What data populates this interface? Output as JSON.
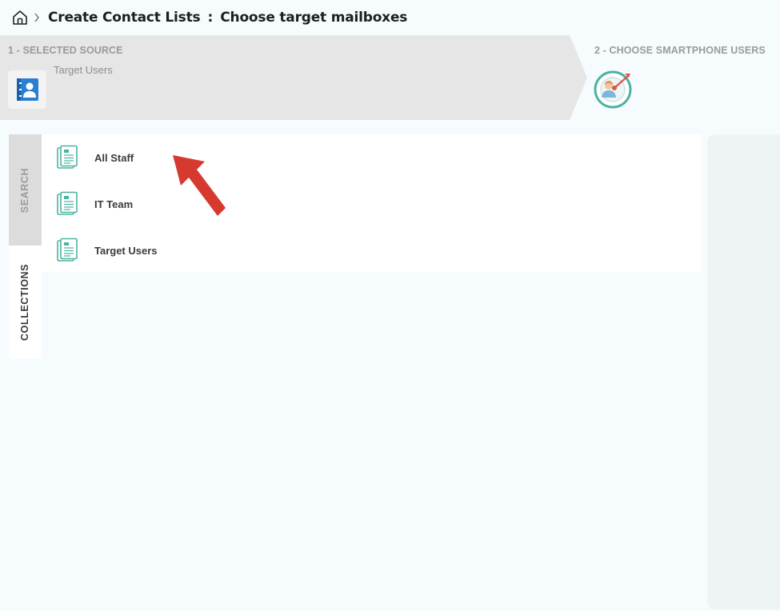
{
  "header": {
    "home_icon": "home-icon",
    "chevron_icon": "chevron-right-icon",
    "title": "Create Contact Lists",
    "separator": ":",
    "subtitle": "Choose target mailboxes"
  },
  "steps": {
    "step1": {
      "label": "1 - SELECTED SOURCE",
      "value": "Target Users",
      "icon": "contact-book-icon"
    },
    "step2": {
      "label": "2 - CHOOSE SMARTPHONE USERS",
      "icon": "target-user-icon"
    }
  },
  "tabs": [
    {
      "label": "SEARCH",
      "active": false
    },
    {
      "label": "COLLECTIONS",
      "active": true
    }
  ],
  "collections": [
    {
      "label": "All Staff",
      "icon": "contact-list-icon"
    },
    {
      "label": "IT Team",
      "icon": "contact-list-icon"
    },
    {
      "label": "Target Users",
      "icon": "contact-list-icon"
    }
  ],
  "colors": {
    "accent_teal": "#4bb3a0",
    "source_blue": "#2a7fd0",
    "annotation_red": "#d63a2f",
    "step_bg": "#e6e6e6"
  }
}
